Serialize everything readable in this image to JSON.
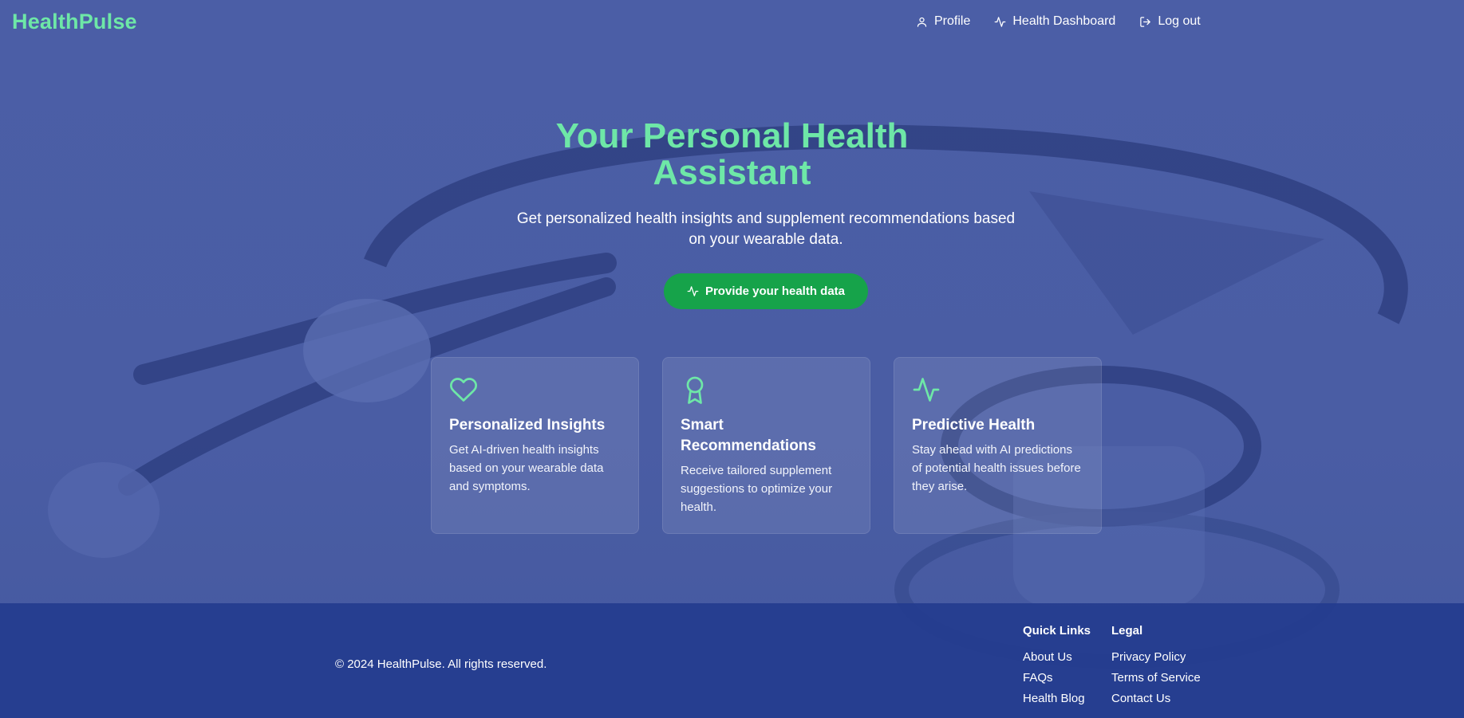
{
  "header": {
    "logo": "HealthPulse",
    "nav": [
      {
        "label": "Profile",
        "icon": "user-icon"
      },
      {
        "label": "Health Dashboard",
        "icon": "activity-icon"
      },
      {
        "label": "Log out",
        "icon": "logout-icon"
      }
    ]
  },
  "hero": {
    "title_line1": "Your Personal Health",
    "title_line2": "Assistant",
    "subtitle": "Get personalized health insights and supplement recommendations based on your wearable data.",
    "cta_label": "Provide your health data",
    "cta_icon": "activity-icon"
  },
  "features": [
    {
      "icon": "heart-icon",
      "title": "Personalized Insights",
      "text": "Get AI-driven health insights based on your wearable data and symptoms."
    },
    {
      "icon": "award-icon",
      "title": "Smart Recommendations",
      "text": "Receive tailored supplement suggestions to optimize your health."
    },
    {
      "icon": "activity-icon",
      "title": "Predictive Health",
      "text": "Stay ahead with AI predictions of potential health issues before they arise."
    }
  ],
  "footer": {
    "copyright": "© 2024 HealthPulse. All rights reserved.",
    "quick_links": {
      "heading": "Quick Links",
      "links": [
        "About Us",
        "FAQs",
        "Health Blog"
      ]
    },
    "legal": {
      "heading": "Legal",
      "links": [
        "Privacy Policy",
        "Terms of Service",
        "Contact Us"
      ]
    }
  },
  "colors": {
    "accent": "#6ee7a7",
    "cta": "#16a34a",
    "overlay": "#4a5fa3",
    "footer": "#243c8e"
  }
}
